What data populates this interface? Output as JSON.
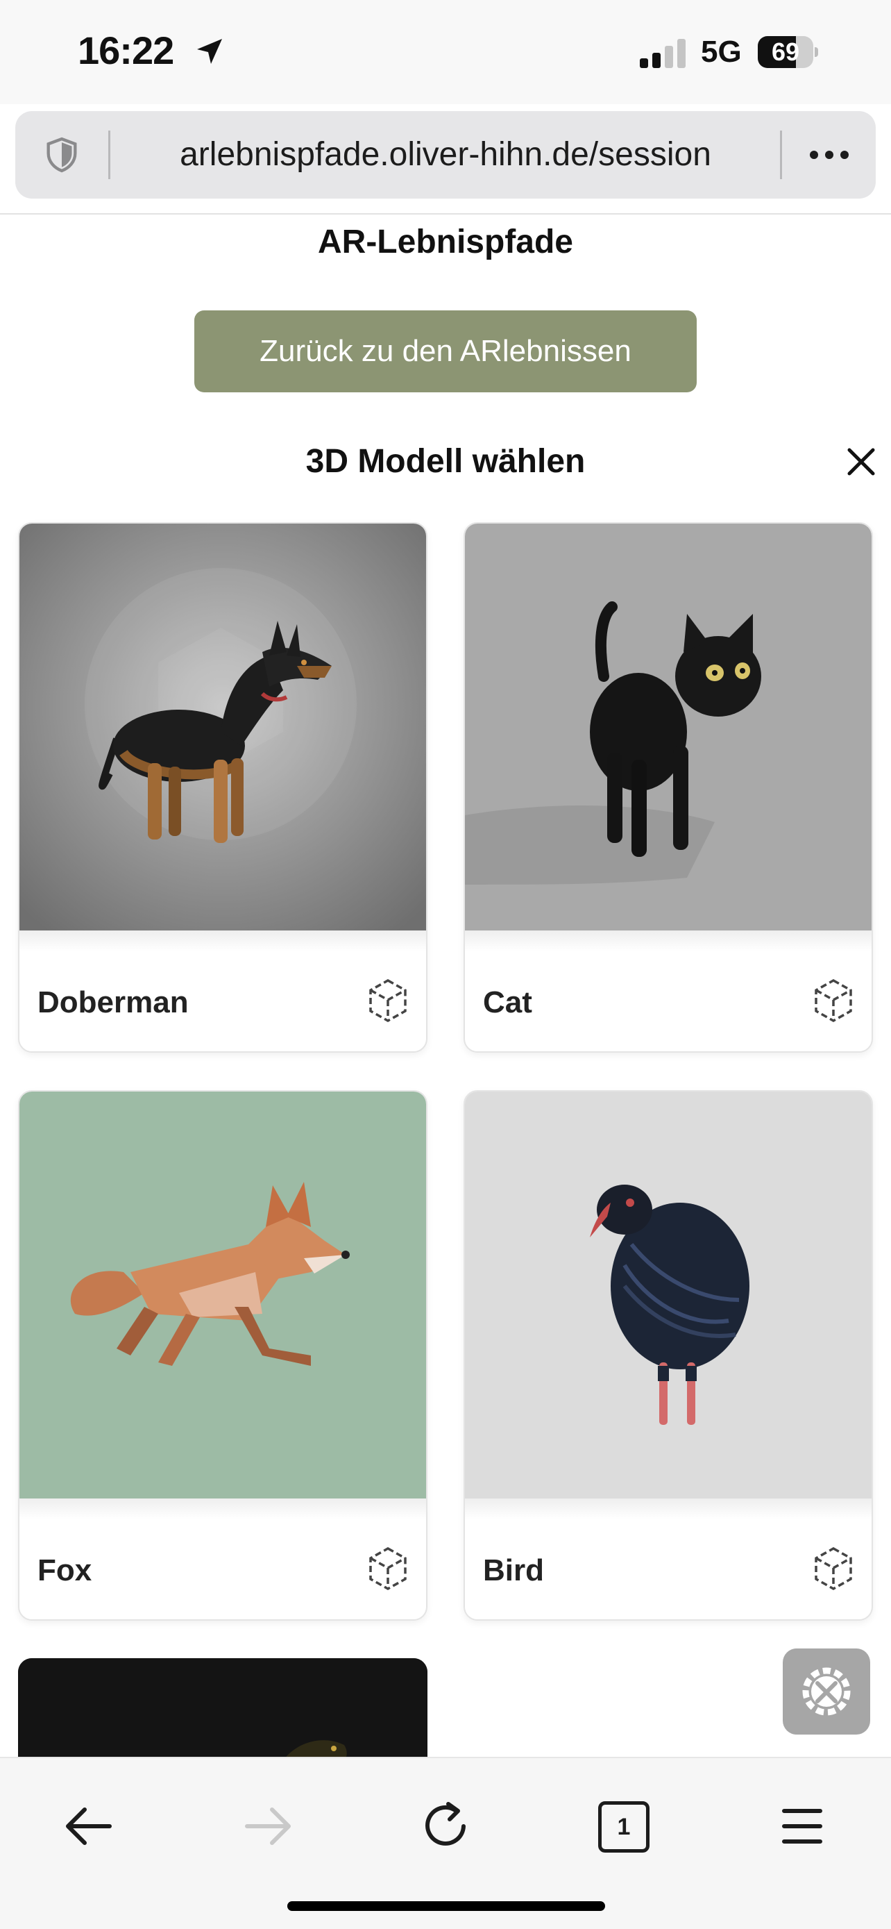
{
  "status_bar": {
    "time": "16:22",
    "network": "5G",
    "battery": "69",
    "battery_level": 0.69,
    "icons": [
      "location-arrow-icon",
      "signal-icon",
      "battery-icon"
    ]
  },
  "browser": {
    "url": "arlebnispfade.oliver-hihn.de/session",
    "icons": [
      "shield-icon",
      "more-icon"
    ],
    "toolbar": {
      "tab_count": "1",
      "icons": [
        "back-arrow-icon",
        "forward-arrow-icon",
        "reload-icon",
        "tabs-icon",
        "menu-icon"
      ]
    }
  },
  "page": {
    "title": "AR-Lebnispfade",
    "back_button": "Zurück zu den ARlebnissen",
    "section_title": "3D Modell wählen",
    "close_icon": "close-icon",
    "models": [
      {
        "name": "Doberman",
        "icon": "3d-cube-icon",
        "background": "#9a9a9a"
      },
      {
        "name": "Cat",
        "icon": "3d-cube-icon",
        "background": "#a9a9a9"
      },
      {
        "name": "Fox",
        "icon": "3d-cube-icon",
        "background": "#9dbba5"
      },
      {
        "name": "Bird",
        "icon": "3d-cube-icon",
        "background": "#dcdcdc"
      }
    ],
    "settings_icon": "settings-tools-icon"
  },
  "colors": {
    "button": "#8c9573",
    "toolbar": "#f6f6f6",
    "address_bar": "#e6e6e8"
  }
}
